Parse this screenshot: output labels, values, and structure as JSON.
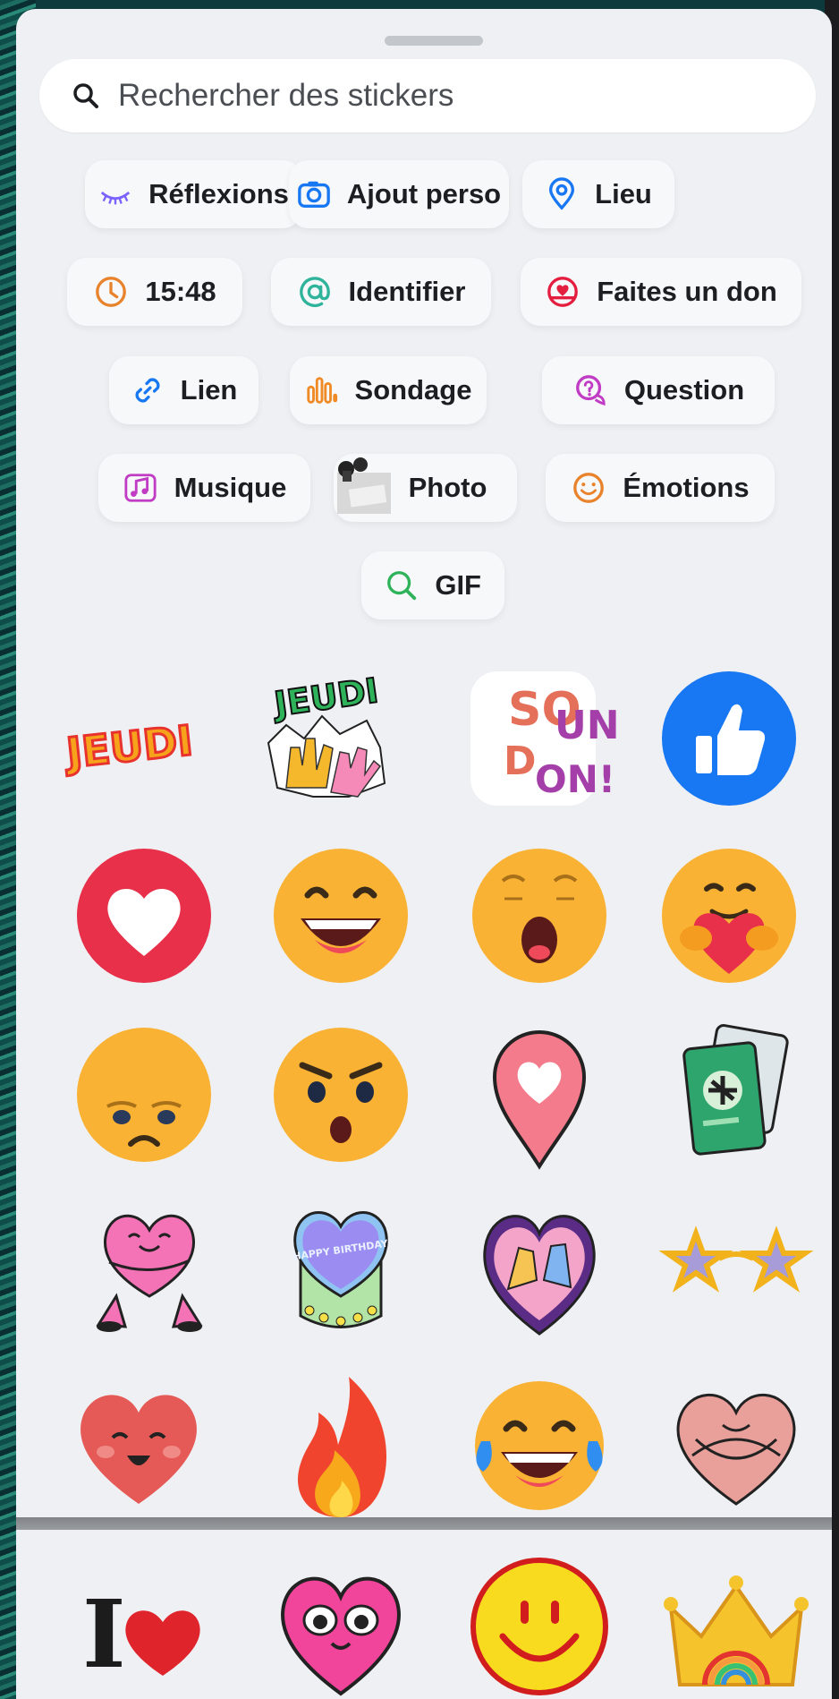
{
  "search": {
    "placeholder": "Rechercher des stickers",
    "icon": "search-icon"
  },
  "chips": [
    {
      "label": "Réflexions",
      "icon": "thoughts-icon",
      "color": "#7b61ff"
    },
    {
      "label": "Ajout perso",
      "icon": "camera-icon",
      "color": "#1877f2"
    },
    {
      "label": "Lieu",
      "icon": "location-pin-icon",
      "color": "#1877f2"
    },
    {
      "label": "15:48",
      "icon": "clock-icon",
      "color": "#e8832c"
    },
    {
      "label": "Identifier",
      "icon": "at-icon",
      "color": "#2fb39a"
    },
    {
      "label": "Faites un don",
      "icon": "donate-icon",
      "color": "#e41e3f"
    },
    {
      "label": "Lien",
      "icon": "link-icon",
      "color": "#1877f2"
    },
    {
      "label": "Sondage",
      "icon": "poll-icon",
      "color": "#f08a24"
    },
    {
      "label": "Question",
      "icon": "question-icon",
      "color": "#c13cc4"
    },
    {
      "label": "Musique",
      "icon": "music-icon",
      "color": "#c13cc4"
    },
    {
      "label": "Photo",
      "icon": "photo-thumbnail",
      "color": "#333333"
    },
    {
      "label": "Émotions",
      "icon": "smiley-icon",
      "color": "#e8832c"
    },
    {
      "label": "GIF",
      "icon": "gif-search-icon",
      "color": "#2fb35a"
    }
  ],
  "stickers": [
    {
      "name": "jeudi-text-sticker",
      "text": "JEUDI"
    },
    {
      "name": "jeudi-hands-sticker",
      "text": "JEUDI"
    },
    {
      "name": "sound-on-sticker",
      "text": "SOUND ON!"
    },
    {
      "name": "like-thumb-sticker"
    },
    {
      "name": "love-heart-sticker"
    },
    {
      "name": "haha-face-sticker"
    },
    {
      "name": "wow-face-sticker"
    },
    {
      "name": "care-hug-sticker"
    },
    {
      "name": "sad-face-sticker"
    },
    {
      "name": "surprised-face-sticker"
    },
    {
      "name": "heart-pin-sticker"
    },
    {
      "name": "passport-sticker"
    },
    {
      "name": "hugging-heart-sticker"
    },
    {
      "name": "birthday-cake-sticker",
      "text": "HAPPY BIRTHDAY"
    },
    {
      "name": "high-five-heart-sticker"
    },
    {
      "name": "star-glasses-sticker"
    },
    {
      "name": "smiling-heart-sticker"
    },
    {
      "name": "fire-sticker"
    },
    {
      "name": "laughing-tears-sticker"
    },
    {
      "name": "pink-hug-heart-sticker"
    },
    {
      "name": "i-love-sticker",
      "text": "I"
    },
    {
      "name": "pink-heart-eyes-sticker"
    },
    {
      "name": "yellow-smiley-sticker"
    },
    {
      "name": "rainbow-crown-sticker"
    }
  ]
}
